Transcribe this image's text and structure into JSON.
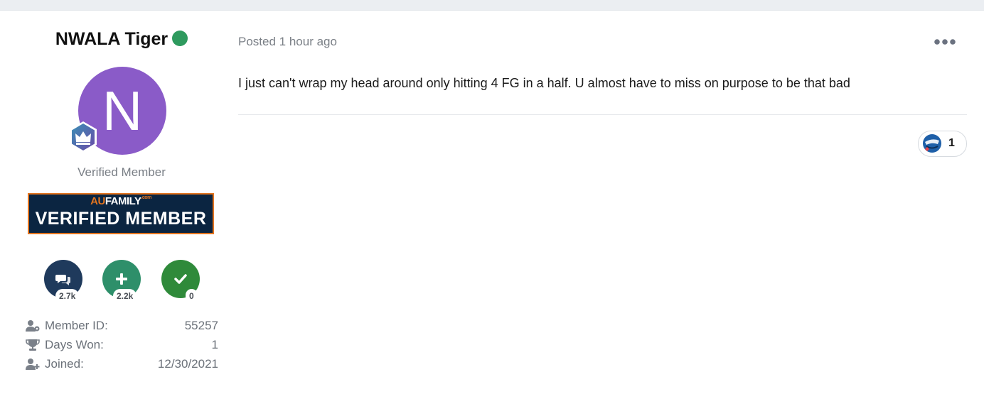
{
  "author": {
    "name": "NWALA Tiger",
    "avatar_letter": "N",
    "avatar_color": "#8a5bc8",
    "online_color": "#2e9a5e",
    "member_title": "Verified Member",
    "banner": {
      "brand_au": "AU",
      "brand_family": "FAMILY",
      "brand_com": ".com",
      "text": "VERIFIED MEMBER"
    },
    "stats": [
      {
        "icon": "comments-icon",
        "count": "2.7k",
        "color": "#1f3a5c"
      },
      {
        "icon": "plus-icon",
        "count": "2.2k",
        "color": "#2e8f6a"
      },
      {
        "icon": "check-icon",
        "count": "0",
        "color": "#2f8a3a"
      }
    ],
    "info": [
      {
        "icon": "member-id-icon",
        "label": "Member ID:",
        "value": "55257"
      },
      {
        "icon": "trophy-icon",
        "label": "Days Won:",
        "value": "1"
      },
      {
        "icon": "user-plus-icon",
        "label": "Joined:",
        "value": "12/30/2021"
      }
    ]
  },
  "post": {
    "posted": "Posted 1 hour ago",
    "body": "I just can't wrap my head around only hitting 4 FG in a half. U almost have to miss on purpose to be that bad",
    "reaction": {
      "icon": "reaction-face-icon",
      "count": "1"
    }
  }
}
